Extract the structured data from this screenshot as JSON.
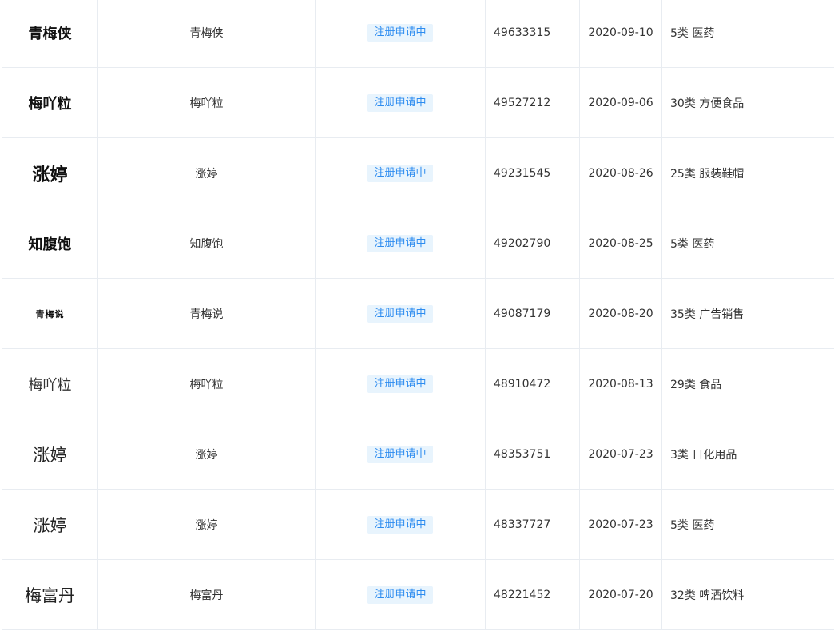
{
  "rows": [
    {
      "logo": "青梅侠",
      "name": "青梅侠",
      "status": "注册申请中",
      "reg_no": "49633315",
      "date": "2020-09-10",
      "class": "5类 医药"
    },
    {
      "logo": "梅吖粒",
      "name": "梅吖粒",
      "status": "注册申请中",
      "reg_no": "49527212",
      "date": "2020-09-06",
      "class": "30类 方便食品"
    },
    {
      "logo": "涨婷",
      "name": "涨婷",
      "status": "注册申请中",
      "reg_no": "49231545",
      "date": "2020-08-26",
      "class": "25类 服装鞋帽"
    },
    {
      "logo": "知腹饱",
      "name": "知腹饱",
      "status": "注册申请中",
      "reg_no": "49202790",
      "date": "2020-08-25",
      "class": "5类 医药"
    },
    {
      "logo": "青梅说",
      "name": "青梅说",
      "status": "注册申请中",
      "reg_no": "49087179",
      "date": "2020-08-20",
      "class": "35类 广告销售"
    },
    {
      "logo": "梅吖粒",
      "name": "梅吖粒",
      "status": "注册申请中",
      "reg_no": "48910472",
      "date": "2020-08-13",
      "class": "29类 食品"
    },
    {
      "logo": "涨婷",
      "name": "涨婷",
      "status": "注册申请中",
      "reg_no": "48353751",
      "date": "2020-07-23",
      "class": "3类 日化用品"
    },
    {
      "logo": "涨婷",
      "name": "涨婷",
      "status": "注册申请中",
      "reg_no": "48337727",
      "date": "2020-07-23",
      "class": "5类 医药"
    },
    {
      "logo": "梅富丹",
      "name": "梅富丹",
      "status": "注册申请中",
      "reg_no": "48221452",
      "date": "2020-07-20",
      "class": "32类 啤酒饮料"
    }
  ],
  "colors": {
    "badge_bg": "#e8f4fd",
    "badge_text": "#2d8cf0",
    "border": "#e8ecf1"
  }
}
